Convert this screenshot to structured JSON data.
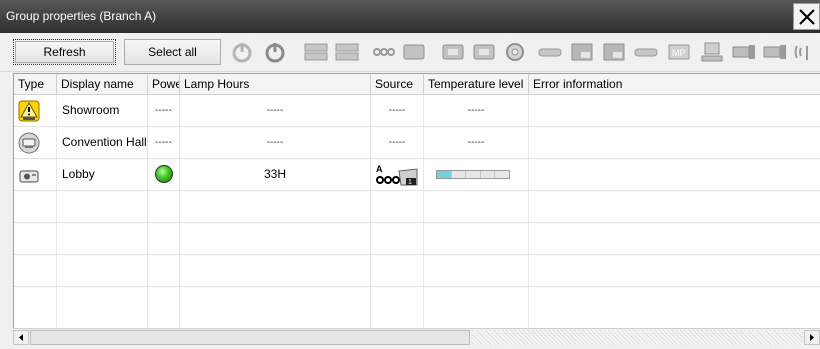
{
  "window": {
    "title": "Group properties (Branch A)"
  },
  "toolbar": {
    "refresh_label": "Refresh",
    "select_all_label": "Select all",
    "icons": [
      "power-on-icon",
      "power-off-icon",
      "computer1-input-icon",
      "computer2-input-icon",
      "video-input-icon",
      "s-video-input-icon",
      "dvi-input-icon",
      "hdmi-input-icon",
      "component-input-icon",
      "usb-input-icon",
      "network-input-icon",
      "lan-input-icon",
      "hdmi1-input-icon",
      "hdmi2-input-icon",
      "mp-input-icon",
      "usb-display-icon",
      "screen1-icon",
      "screen2-icon",
      "wireless-icon"
    ]
  },
  "grid": {
    "columns": [
      "Type",
      "Display name",
      "Power",
      "Lamp Hours",
      "Source",
      "Temperature level",
      "Error information"
    ],
    "rows": [
      {
        "type_icon": "warning-projector-icon",
        "name": "Showroom",
        "power": "-----",
        "lamp_hours": "-----",
        "source": "-----",
        "temperature": "-----",
        "error": ""
      },
      {
        "type_icon": "standby-projector-icon",
        "name": "Convention Hall",
        "power": "-----",
        "lamp_hours": "-----",
        "source": "-----",
        "temperature": "-----",
        "error": ""
      },
      {
        "type_icon": "projector-icon",
        "name": "Lobby",
        "power": "on",
        "lamp_hours": "33H",
        "source": "A Computer1",
        "temperature_level": 0.2,
        "error": ""
      }
    ]
  },
  "colors": {
    "power_on": "#3ec41f",
    "temperature_fill": "#6fd3dc",
    "title_bar": "#3a3a3a",
    "warning_yellow": "#ffd400"
  }
}
